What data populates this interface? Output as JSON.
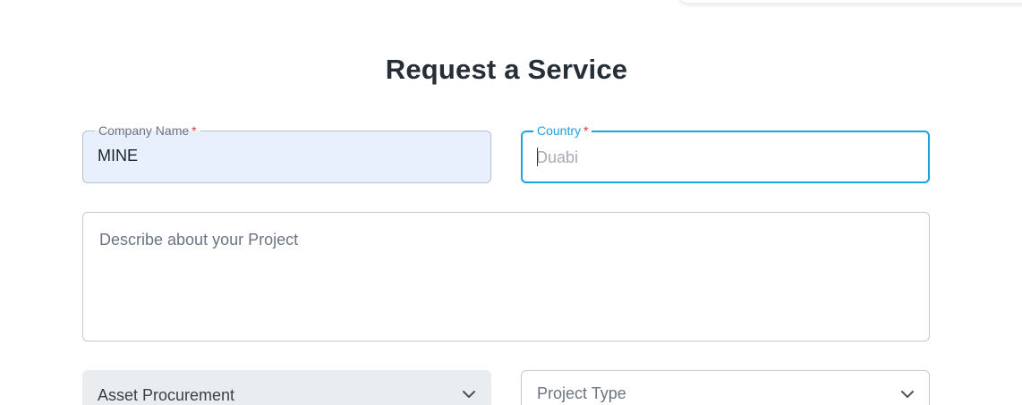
{
  "form": {
    "title": "Request a Service",
    "company_name": {
      "label": "Company Name",
      "required_mark": "*",
      "value": "MINE"
    },
    "country": {
      "label": "Country",
      "required_mark": "*",
      "placeholder": "Duabi",
      "value": ""
    },
    "description": {
      "placeholder": "Describe about your Project"
    },
    "service_select": {
      "selected": "Asset Procurement",
      "icon": "chevron-down-icon"
    },
    "project_type_select": {
      "placeholder": "Project Type",
      "icon": "chevron-down-icon"
    }
  },
  "colors": {
    "accent": "#1aa3e0",
    "required": "#e53935",
    "autofill_bg": "#e8f0fe",
    "title": "#262e36"
  }
}
